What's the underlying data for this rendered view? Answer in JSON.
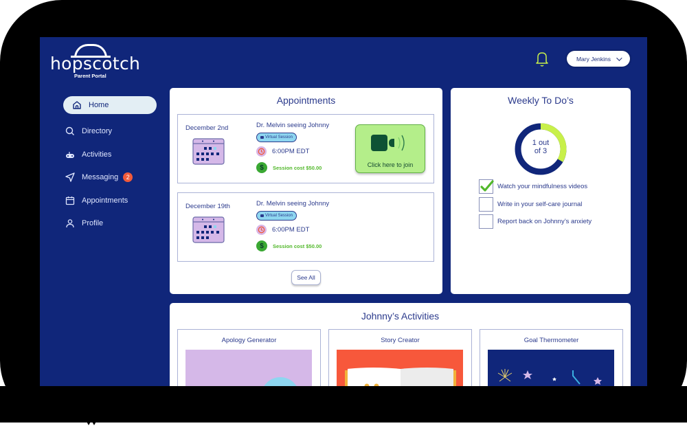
{
  "app": {
    "logo_text": "hopscotch",
    "logo_subtitle": "Parent Portal"
  },
  "header": {
    "notification_icon": "bell-icon",
    "user_name": "Mary Jenkins",
    "user_menu_icon": "chevron-down-icon"
  },
  "sidebar": {
    "items": [
      {
        "label": "Home",
        "icon": "home-icon",
        "active": true
      },
      {
        "label": "Directory",
        "icon": "search-icon"
      },
      {
        "label": "Activities",
        "icon": "gamepad-icon"
      },
      {
        "label": "Messaging",
        "icon": "send-icon",
        "badge": "2"
      },
      {
        "label": "Appointments",
        "icon": "calendar-icon"
      },
      {
        "label": "Profile",
        "icon": "user-icon"
      }
    ]
  },
  "appointments": {
    "title": "Appointments",
    "items": [
      {
        "date": "December 2nd",
        "doctor": "Dr. Melvin seeing Johnny",
        "session_type": "Virtual Session",
        "time": "6:00PM EDT",
        "cost": "Session cost $50.00",
        "join_label": "Click here to join"
      },
      {
        "date": "December 19th",
        "doctor": "Dr. Melvin seeing Johnny",
        "session_type": "Virtual Session",
        "time": "6:00PM EDT",
        "cost": "Session cost $50.00"
      }
    ],
    "see_all_label": "See All"
  },
  "todo": {
    "title": "Weekly To Do’s",
    "progress_label_line1": "1 out",
    "progress_label_line2": "of 3",
    "completed": 1,
    "total": 3,
    "items": [
      {
        "label": "Watch your mindfulness videos",
        "checked": true
      },
      {
        "label": "Write in your self-care journal",
        "checked": false
      },
      {
        "label": "Report back on Johnny’s anxiety",
        "checked": false
      }
    ]
  },
  "activities": {
    "title": "Johnny’s Activities",
    "items": [
      {
        "title": "Apology Generator",
        "bg_color": "#d5b8e8"
      },
      {
        "title": "Story Creator",
        "bg_color": "#f7583b"
      },
      {
        "title": "Goal Thermometer",
        "bg_color": "#10267a"
      }
    ]
  },
  "colors": {
    "brand_navy": "#10267a",
    "accent_lime": "#c8f04a",
    "join_green": "#b4ee8a",
    "badge_red": "#f25a3a"
  }
}
